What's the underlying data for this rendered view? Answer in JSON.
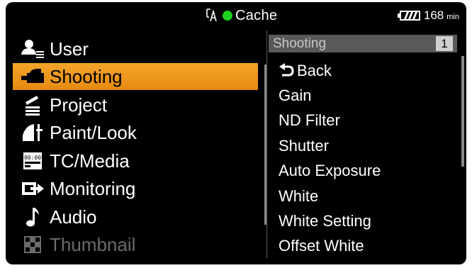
{
  "status": {
    "cache_label": "Cache",
    "cache_icon": "card-slot-icon",
    "rec_indicator_color": "#1ed11e",
    "battery_value": "168",
    "battery_unit": "min",
    "battery_icon": "battery-icon"
  },
  "menu": {
    "items": [
      {
        "label": "User",
        "icon": "user-list-icon",
        "state": "normal"
      },
      {
        "label": "Shooting",
        "icon": "camera-icon",
        "state": "selected"
      },
      {
        "label": "Project",
        "icon": "clapper-icon",
        "state": "normal"
      },
      {
        "label": "Paint/Look",
        "icon": "paint-icon",
        "state": "normal"
      },
      {
        "label": "TC/Media",
        "icon": "timecode-icon",
        "state": "normal"
      },
      {
        "label": "Monitoring",
        "icon": "output-icon",
        "state": "normal"
      },
      {
        "label": "Audio",
        "icon": "music-note-icon",
        "state": "normal"
      },
      {
        "label": "Thumbnail",
        "icon": "thumbnail-grid-icon",
        "state": "disabled"
      }
    ],
    "selected_color": "#f0a020"
  },
  "submenu": {
    "title": "Shooting",
    "page": "1",
    "back_label": "Back",
    "items": [
      "Gain",
      "ND Filter",
      "Shutter",
      "Auto Exposure",
      "White",
      "White Setting",
      "Offset White"
    ]
  }
}
